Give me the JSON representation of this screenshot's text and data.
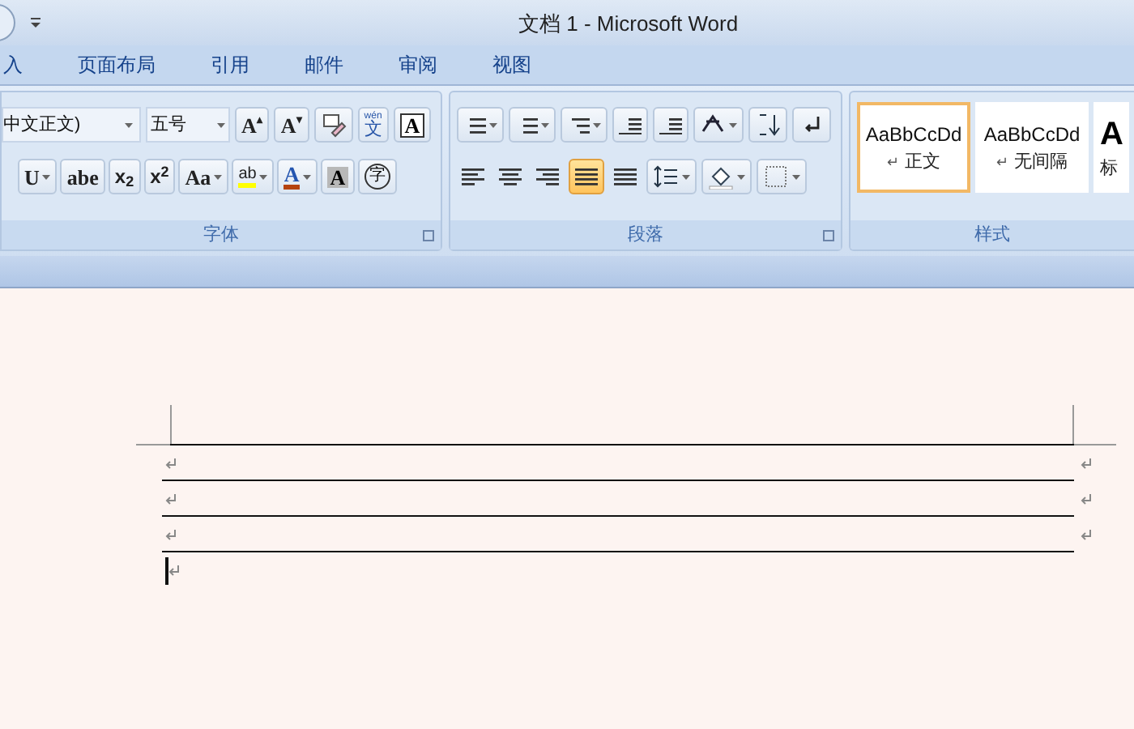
{
  "window": {
    "title": "文档 1 - Microsoft Word"
  },
  "tabs": [
    {
      "label": "入",
      "selected": false
    },
    {
      "label": "页面布局",
      "selected": false
    },
    {
      "label": "引用",
      "selected": false
    },
    {
      "label": "邮件",
      "selected": false
    },
    {
      "label": "审阅",
      "selected": false
    },
    {
      "label": "视图",
      "selected": false
    }
  ],
  "font_group": {
    "font_name": "中文正文)",
    "font_size": "五号",
    "label": "字体",
    "row1": [
      {
        "kind": "grow",
        "label": "A",
        "sup": "▴"
      },
      {
        "kind": "shrink",
        "label": "A",
        "sup": "▾"
      },
      {
        "kind": "clear"
      },
      {
        "kind": "phonetic",
        "label": "文",
        "sup": "wén"
      },
      {
        "kind": "boxed",
        "label": "A"
      }
    ],
    "row2": [
      {
        "kind": "underline",
        "label": "U",
        "dropdown": true
      },
      {
        "kind": "strike",
        "label": "abe",
        "dropdown": false
      },
      {
        "kind": "subscript",
        "label": "x$_{2}$",
        "dropdown": false
      },
      {
        "kind": "superscript",
        "label": "x$^{2}$",
        "dropdown": false
      },
      {
        "kind": "case",
        "label": "Aa",
        "dropdown": true
      },
      {
        "kind": "highlight",
        "label": "ab",
        "dropdown": true
      },
      {
        "kind": "fontcolor",
        "label": "A",
        "dropdown": true
      },
      {
        "kind": "shaded",
        "label": "A",
        "dropdown": false
      },
      {
        "kind": "circled",
        "label": "字",
        "dropdown": false
      }
    ]
  },
  "paragraph_group": {
    "label": "段落",
    "align": [
      {
        "selected": false
      },
      {
        "selected": false
      },
      {
        "selected": false
      },
      {
        "selected": true
      },
      {
        "selected": false
      }
    ]
  },
  "styles_group": {
    "label": "样式",
    "styles": [
      {
        "preview": "AaBbCcDd",
        "mark": "↵",
        "name": "正文",
        "selected": true
      },
      {
        "preview": "AaBbCcDd",
        "mark": "↵",
        "name": "无间隔",
        "selected": false
      },
      {
        "preview": "A",
        "name": "标",
        "selected": false
      }
    ]
  }
}
